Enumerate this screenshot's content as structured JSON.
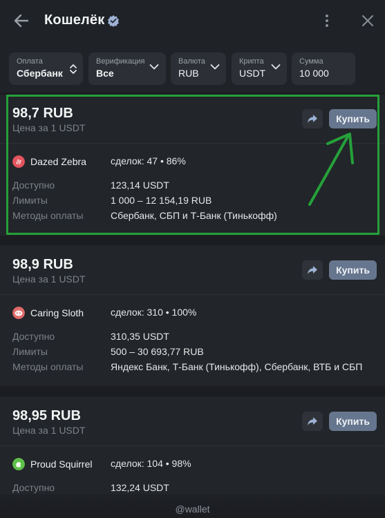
{
  "header": {
    "title": "Кошелёк"
  },
  "filters": [
    {
      "label": "Оплата",
      "value": "Сбербанк"
    },
    {
      "label": "Верификация",
      "value": "Все"
    },
    {
      "label": "Валюта",
      "value": "RUB"
    },
    {
      "label": "Крипта",
      "value": "USDT"
    },
    {
      "label": "Сумма",
      "value": "10 000"
    }
  ],
  "buy_label": "Купить",
  "row_labels": {
    "available": "Доступно",
    "limits": "Лимиты",
    "methods": "Методы оплаты"
  },
  "offers": [
    {
      "price": "98,7 RUB",
      "per": "Цена за 1 USDT",
      "trader": "Dazed Zebra",
      "deals": "сделок: 47 • 86%",
      "available": "123,14 USDT",
      "limits": "1 000 – 12 154,19 RUB",
      "methods": "Сбербанк, СБП и Т-Банк (Тинькофф)",
      "avatar_color": "#e2545d"
    },
    {
      "price": "98,9 RUB",
      "per": "Цена за 1 USDT",
      "trader": "Caring Sloth",
      "deals": "сделок: 310 • 100%",
      "available": "310,35 USDT",
      "limits": "500 – 30 693,77 RUB",
      "methods": "Яндекс Банк, Т-Банк (Тинькофф), Сбербанк, ВТБ и СБП",
      "avatar_color": "#e06a6a"
    },
    {
      "price": "98,95 RUB",
      "per": "Цена за 1 USDT",
      "trader": "Proud Squirrel",
      "deals": "сделок: 104 • 98%",
      "available": "132,24 USDT",
      "avatar_color": "#5fbf4a"
    }
  ],
  "footer": "@wallet",
  "colors": {
    "accent_button": "#66768e",
    "highlight": "#25a03a",
    "background": "#1b1d21"
  }
}
